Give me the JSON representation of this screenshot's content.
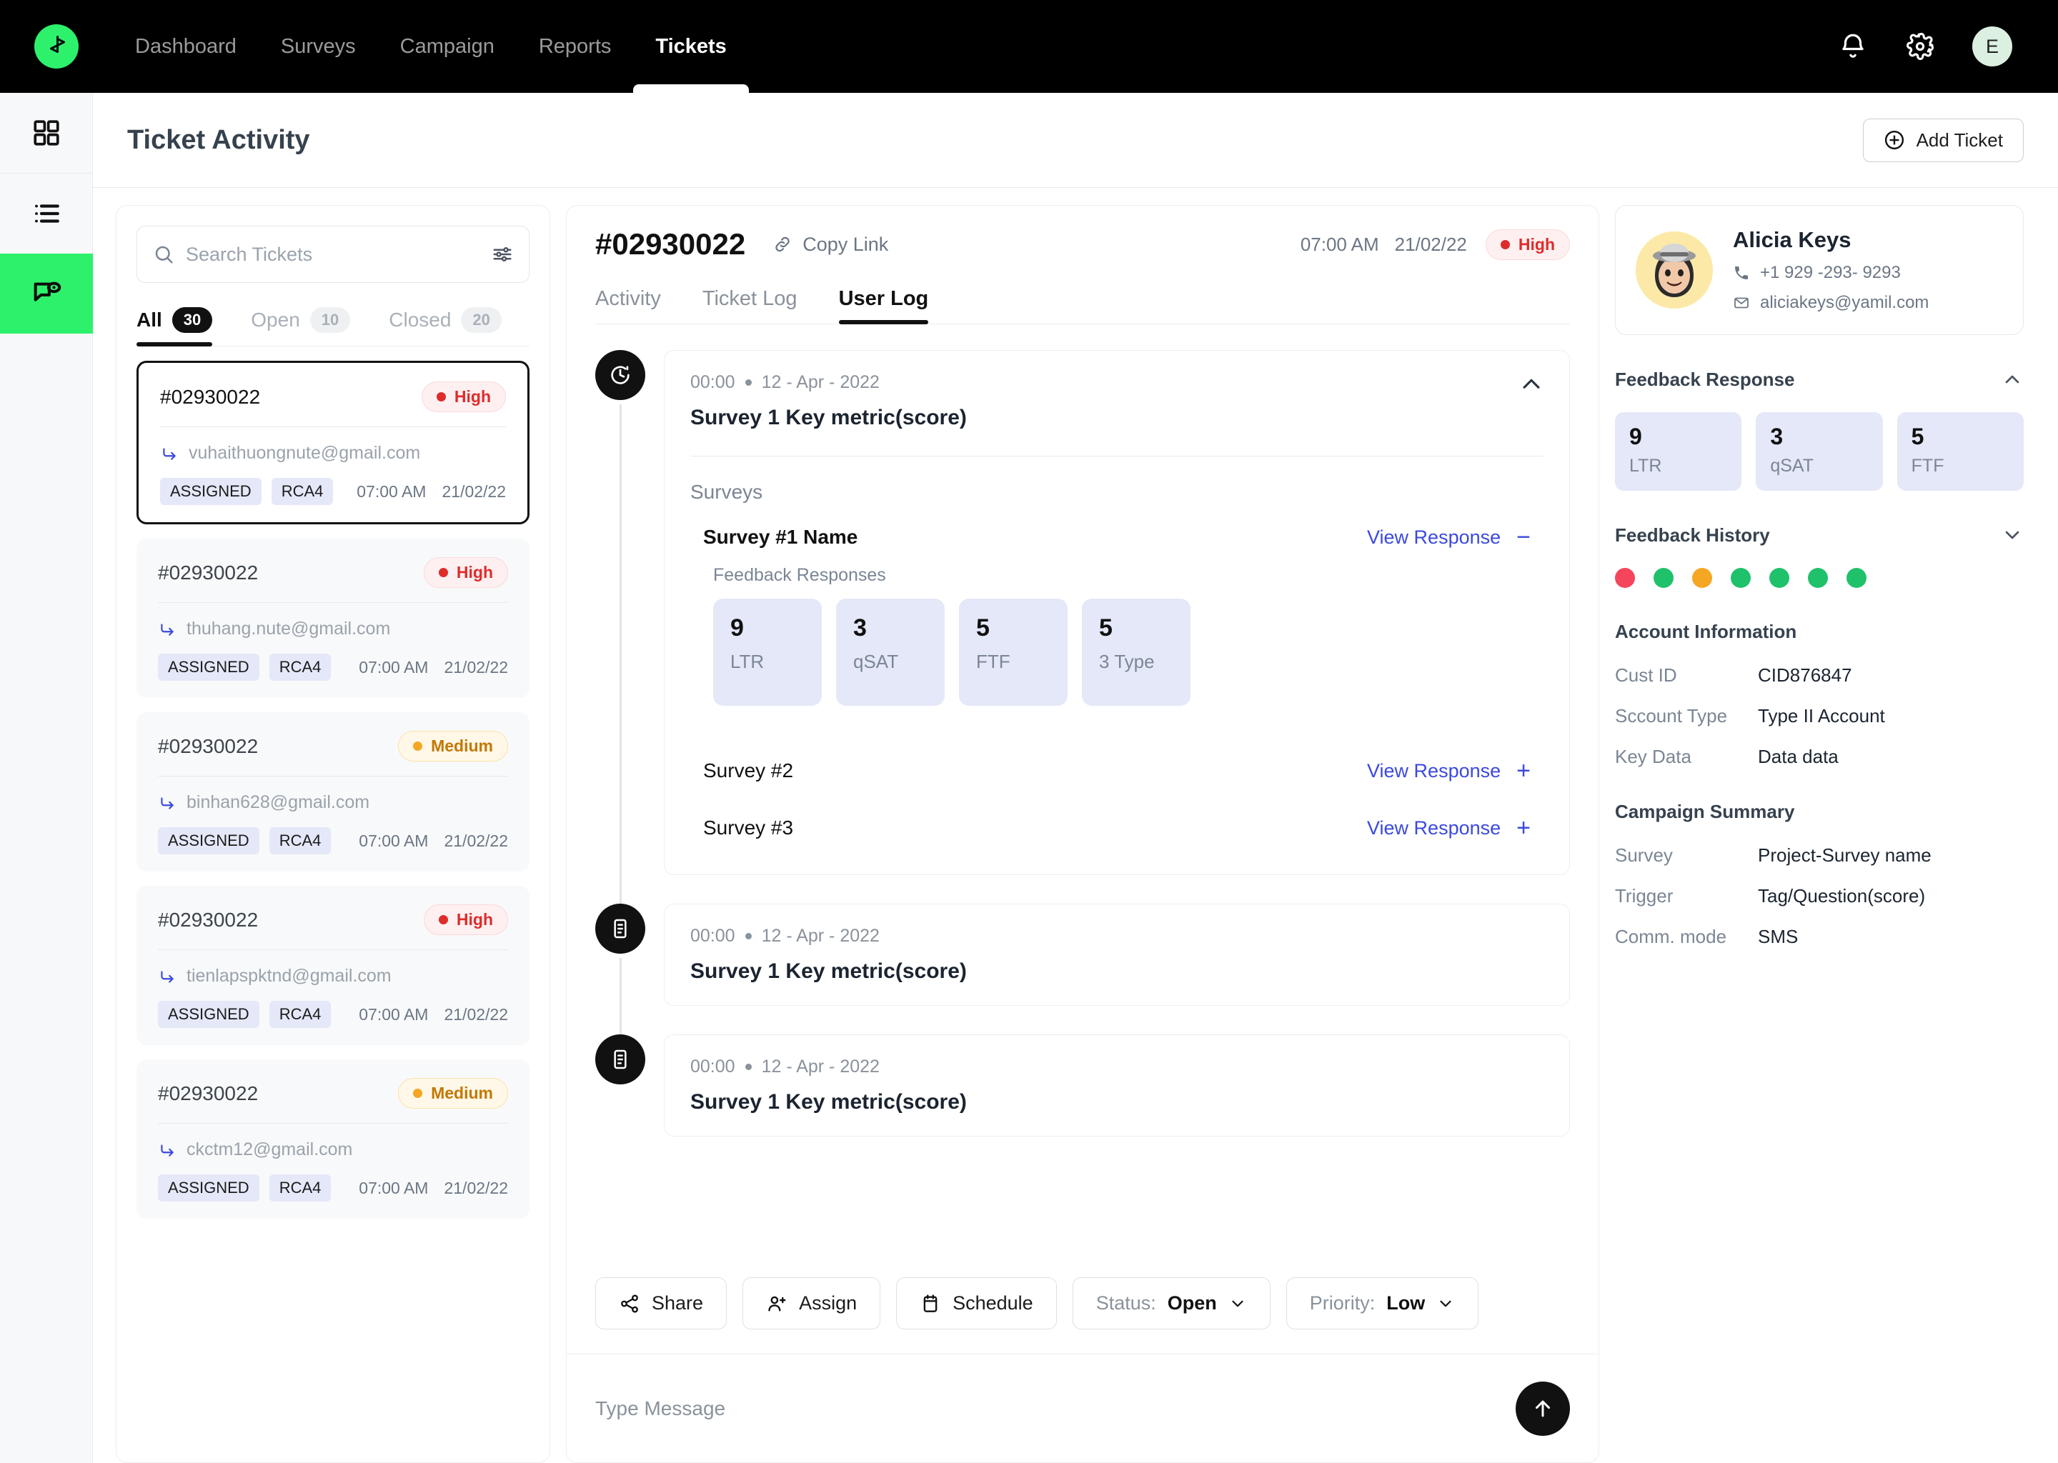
{
  "topnav": {
    "logo_icon": "play-flag-logo-icon",
    "items": [
      {
        "label": "Dashboard",
        "active": false
      },
      {
        "label": "Surveys",
        "active": false
      },
      {
        "label": "Campaign",
        "active": false
      },
      {
        "label": "Reports",
        "active": false
      },
      {
        "label": "Tickets",
        "active": true
      }
    ],
    "bell_icon": "notification-bell-icon",
    "gear_icon": "settings-gear-icon",
    "avatar_initial": "E"
  },
  "rail": {
    "items": [
      {
        "icon": "grid-dashboard-icon",
        "active": false
      },
      {
        "icon": "list-icon",
        "active": false
      },
      {
        "icon": "chat-eye-icon",
        "active": true
      }
    ]
  },
  "pagehead": {
    "title": "Ticket Activity",
    "add_button": "Add Ticket",
    "add_icon": "plus-circle-icon"
  },
  "ticketlist": {
    "search": {
      "placeholder": "Search Tickets",
      "value": "",
      "search_icon": "search-icon",
      "filter_icon": "filter-sliders-icon"
    },
    "tabs": [
      {
        "label": "All",
        "count": "30",
        "active": true
      },
      {
        "label": "Open",
        "count": "10",
        "active": false
      },
      {
        "label": "Closed",
        "count": "20",
        "active": false
      }
    ],
    "tickets": [
      {
        "id": "#02930022",
        "priority": "High",
        "priority_level": "high",
        "email": "vuhaithuongnute@gmail.com",
        "chips": [
          "ASSIGNED",
          "RCA4"
        ],
        "time": "07:00 AM",
        "date": "21/02/22",
        "selected": true
      },
      {
        "id": "#02930022",
        "priority": "High",
        "priority_level": "high",
        "email": "thuhang.nute@gmail.com",
        "chips": [
          "ASSIGNED",
          "RCA4"
        ],
        "time": "07:00 AM",
        "date": "21/02/22",
        "selected": false
      },
      {
        "id": "#02930022",
        "priority": "Medium",
        "priority_level": "medium",
        "email": "binhan628@gmail.com",
        "chips": [
          "ASSIGNED",
          "RCA4"
        ],
        "time": "07:00 AM",
        "date": "21/02/22",
        "selected": false
      },
      {
        "id": "#02930022",
        "priority": "High",
        "priority_level": "high",
        "email": "tienlapspktnd@gmail.com",
        "chips": [
          "ASSIGNED",
          "RCA4"
        ],
        "time": "07:00 AM",
        "date": "21/02/22",
        "selected": false
      },
      {
        "id": "#02930022",
        "priority": "Medium",
        "priority_level": "medium",
        "email": "ckctm12@gmail.com",
        "chips": [
          "ASSIGNED",
          "RCA4"
        ],
        "time": "07:00 AM",
        "date": "21/02/22",
        "selected": false
      }
    ]
  },
  "detail": {
    "ticket_id": "#02930022",
    "copy_link": "Copy Link",
    "copy_icon": "link-icon",
    "time": "07:00 AM",
    "date": "21/02/22",
    "priority": "High",
    "tabs": [
      {
        "label": "Activity",
        "active": false
      },
      {
        "label": "Ticket Log",
        "active": false
      },
      {
        "label": "User Log",
        "active": true
      }
    ],
    "entries": [
      {
        "icon": "clock-icon",
        "time": "00:00",
        "date": "12 - Apr - 2022",
        "title": "Survey 1 Key metric(score)",
        "expanded": true,
        "surveys_label": "Surveys",
        "surveys": [
          {
            "name": "Survey #1 Name",
            "view_label": "View Response",
            "toggle": "−",
            "expanded": true,
            "feedback_label": "Feedback Responses",
            "scores": [
              {
                "num": "9",
                "label": "LTR"
              },
              {
                "num": "3",
                "label": "qSAT"
              },
              {
                "num": "5",
                "label": "FTF"
              },
              {
                "num": "5",
                "label": "3 Type"
              }
            ]
          },
          {
            "name": "Survey #2",
            "view_label": "View Response",
            "toggle": "+",
            "expanded": false
          },
          {
            "name": "Survey #3",
            "view_label": "View Response",
            "toggle": "+",
            "expanded": false
          }
        ]
      },
      {
        "icon": "document-icon",
        "time": "00:00",
        "date": "12 - Apr - 2022",
        "title": "Survey 1 Key metric(score)",
        "expanded": false
      },
      {
        "icon": "document-icon",
        "time": "00:00",
        "date": "12 - Apr - 2022",
        "title": "Survey 1 Key metric(score)",
        "expanded": false
      }
    ],
    "actions": [
      {
        "label": "Share",
        "icon": "share-icon",
        "type": "plain"
      },
      {
        "label": "Assign",
        "icon": "user-plus-icon",
        "type": "plain"
      },
      {
        "label": "Schedule",
        "icon": "calendar-icon",
        "type": "plain"
      },
      {
        "prefix": "Status:",
        "label": "Open",
        "type": "select",
        "icon": "chevron-down-icon"
      },
      {
        "prefix": "Priority:",
        "label": "Low",
        "type": "select",
        "icon": "chevron-down-icon"
      }
    ],
    "composer": {
      "placeholder": "Type Message",
      "value": "",
      "send_icon": "arrow-up-icon"
    }
  },
  "side": {
    "profile": {
      "avatar": "memoji-avatar",
      "name": "Alicia Keys",
      "phone": "+1 929 -293- 9293",
      "phone_icon": "phone-icon",
      "email": "aliciakeys@yamil.com",
      "email_icon": "envelope-icon"
    },
    "feedback_response": {
      "title": "Feedback Response",
      "chevron": "chevron-up-icon",
      "scores": [
        {
          "num": "9",
          "label": "LTR"
        },
        {
          "num": "3",
          "label": "qSAT"
        },
        {
          "num": "5",
          "label": "FTF"
        }
      ]
    },
    "feedback_history": {
      "title": "Feedback History",
      "chevron": "chevron-down-icon",
      "dots": [
        "#F5455C",
        "#1FC16B",
        "#F5A623",
        "#1FC16B",
        "#1FC16B",
        "#1FC16B",
        "#1FC16B"
      ]
    },
    "account_information": {
      "title": "Account Information",
      "rows": [
        {
          "k": "Cust ID",
          "v": "CID876847"
        },
        {
          "k": "Sccount Type",
          "v": "Type II Account"
        },
        {
          "k": "Key Data",
          "v": "Data data"
        }
      ]
    },
    "campaign_summary": {
      "title": "Campaign Summary",
      "rows": [
        {
          "k": "Survey",
          "v": "Project-Survey name"
        },
        {
          "k": "Trigger",
          "v": "Tag/Question(score)"
        },
        {
          "k": "Comm. mode",
          "v": "SMS"
        }
      ]
    }
  },
  "colors": {
    "brand_green": "#2DF16B",
    "high": "#E02B2B",
    "medium": "#F5A623",
    "link_blue": "#3B49DF",
    "score_bg": "#E4E8F8"
  }
}
